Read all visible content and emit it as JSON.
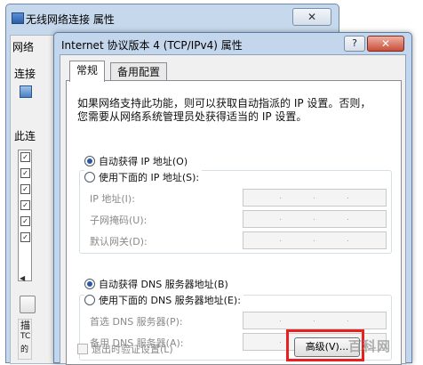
{
  "outer_window": {
    "title": "无线网络连接 属性",
    "close_label": "✕",
    "tab_label": "网络",
    "connect_label": "连接",
    "items_label": "此连",
    "desc_label": "描",
    "tc_label": "TC",
    "p_label": "的"
  },
  "dialog": {
    "title": "Internet 协议版本 4 (TCP/IPv4) 属性",
    "help_label": "?",
    "close_label": "✕",
    "tabs": [
      {
        "label": "常规"
      },
      {
        "label": "备用配置"
      }
    ],
    "description_line1": "如果网络支持此功能，则可以获取自动指派的 IP 设置。否则，",
    "description_line2": "您需要从网络系统管理员处获得适当的 IP 设置。",
    "ip_auto_label": "自动获得 IP 地址(O)",
    "ip_manual_label": "使用下面的 IP 地址(S):",
    "ip_fields": [
      {
        "label": "IP 地址(I):"
      },
      {
        "label": "子网掩码(U):"
      },
      {
        "label": "默认网关(D):"
      }
    ],
    "dns_auto_label": "自动获得 DNS 服务器地址(B)",
    "dns_manual_label": "使用下面的 DNS 服务器地址(E):",
    "dns_fields": [
      {
        "label": "首选 DNS 服务器(P):"
      },
      {
        "label": "备用 DNS 服务器(A):"
      }
    ],
    "dot_char": ".",
    "validate_label": "退出时验证设置(L)",
    "advanced_label": "高级(V)..."
  },
  "watermark": "百科网",
  "colors": {
    "highlight": "#e8201f",
    "dialog_frame": "#c3d6ec",
    "radio_selected": "#2a57a8"
  }
}
